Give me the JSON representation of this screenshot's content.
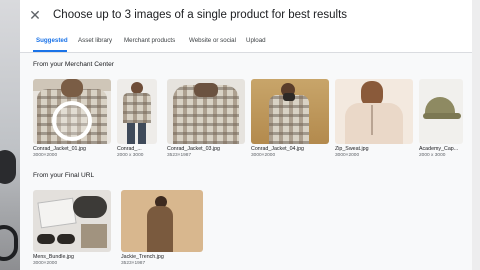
{
  "dialog": {
    "title": "Choose up to 3 images of a single product for best results",
    "close_icon": "close-icon"
  },
  "tabs": [
    {
      "label": "Suggested",
      "active": true
    },
    {
      "label": "Asset library",
      "active": false
    },
    {
      "label": "Merchant products",
      "active": false
    },
    {
      "label": "Website or social",
      "active": false
    },
    {
      "label": "Upload",
      "active": false
    }
  ],
  "merchant": {
    "title": "From your Merchant Center",
    "items": [
      {
        "name": "Conrad_Jacket_01.jpg",
        "size": "3000×2000",
        "selected": true
      },
      {
        "name": "Conrad_...",
        "size": "2000 x 3000"
      },
      {
        "name": "Conrad_Jacket_03.jpg",
        "size": "3523×1987"
      },
      {
        "name": "Conrad_Jacket_04.jpg",
        "size": "3000×2000"
      },
      {
        "name": "Zip_Sweat.jpg",
        "size": "3000×2000"
      },
      {
        "name": "Academy_Cap...",
        "size": "2000 x 3000"
      }
    ]
  },
  "final_url": {
    "title": "From your Final URL",
    "items": [
      {
        "name": "Mens_Bundle.jpg",
        "size": "3000×2000"
      },
      {
        "name": "Jackie_Trench.jpg",
        "size": "3523×1987"
      }
    ]
  },
  "colors": {
    "accent": "#1a73e8",
    "text": "#202124",
    "muted": "#5f6368"
  }
}
